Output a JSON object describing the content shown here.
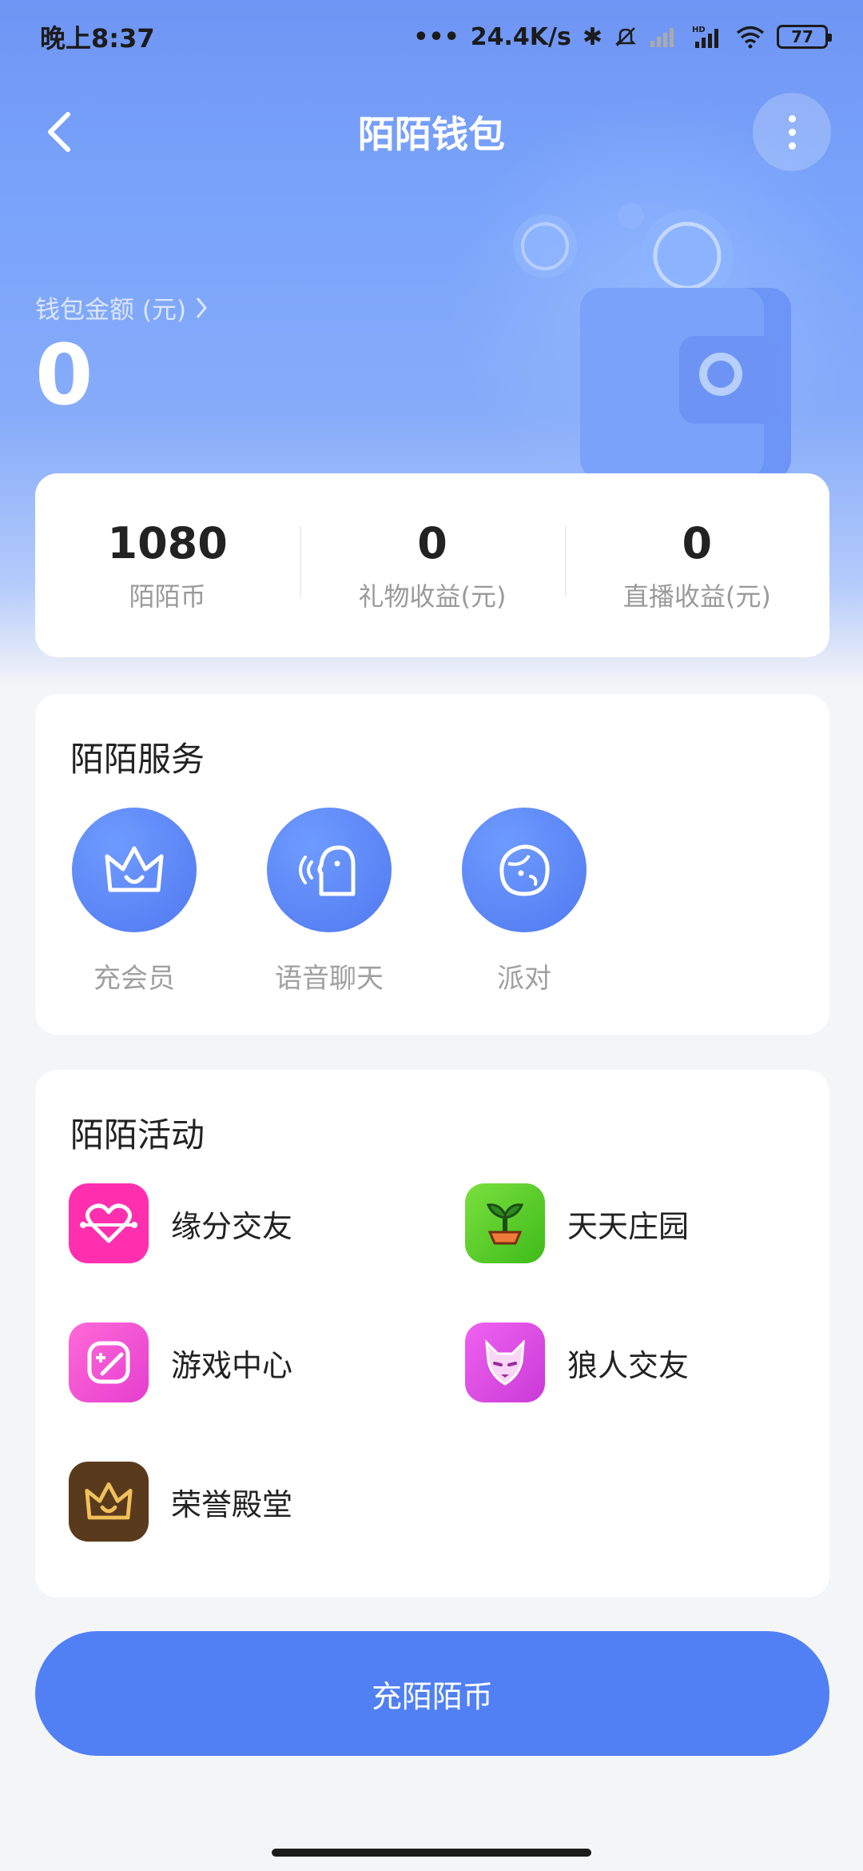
{
  "status_bar": {
    "time": "晚上8:37",
    "network_speed": "24.4K/s",
    "battery": "77"
  },
  "header": {
    "title": "陌陌钱包"
  },
  "wallet": {
    "label": "钱包金额 (元)",
    "amount": "0"
  },
  "stats": [
    {
      "value": "1080",
      "label": "陌陌币"
    },
    {
      "value": "0",
      "label": "礼物收益(元)"
    },
    {
      "value": "0",
      "label": "直播收益(元)"
    }
  ],
  "services": {
    "title": "陌陌服务",
    "items": [
      {
        "label": "充会员",
        "icon": "crown-icon"
      },
      {
        "label": "语音聊天",
        "icon": "voice-chat-icon"
      },
      {
        "label": "派对",
        "icon": "party-icon"
      }
    ]
  },
  "activities": {
    "title": "陌陌活动",
    "items": [
      {
        "label": "缘分交友",
        "icon": "heart-icon",
        "color": "#ff2fae"
      },
      {
        "label": "天天庄园",
        "icon": "sprout-icon",
        "color": "#5cd42e"
      },
      {
        "label": "游戏中心",
        "icon": "gamepad-icon",
        "color": "#ff4fd0"
      },
      {
        "label": "狼人交友",
        "icon": "wolf-icon",
        "color": "#e44be8"
      },
      {
        "label": "荣誉殿堂",
        "icon": "crown-icon",
        "color": "#5a3a1c"
      }
    ]
  },
  "footer": {
    "recharge_label": "充陌陌币"
  },
  "colors": {
    "accent": "#5180f5",
    "header_gradient_top": "#6f95f4"
  }
}
